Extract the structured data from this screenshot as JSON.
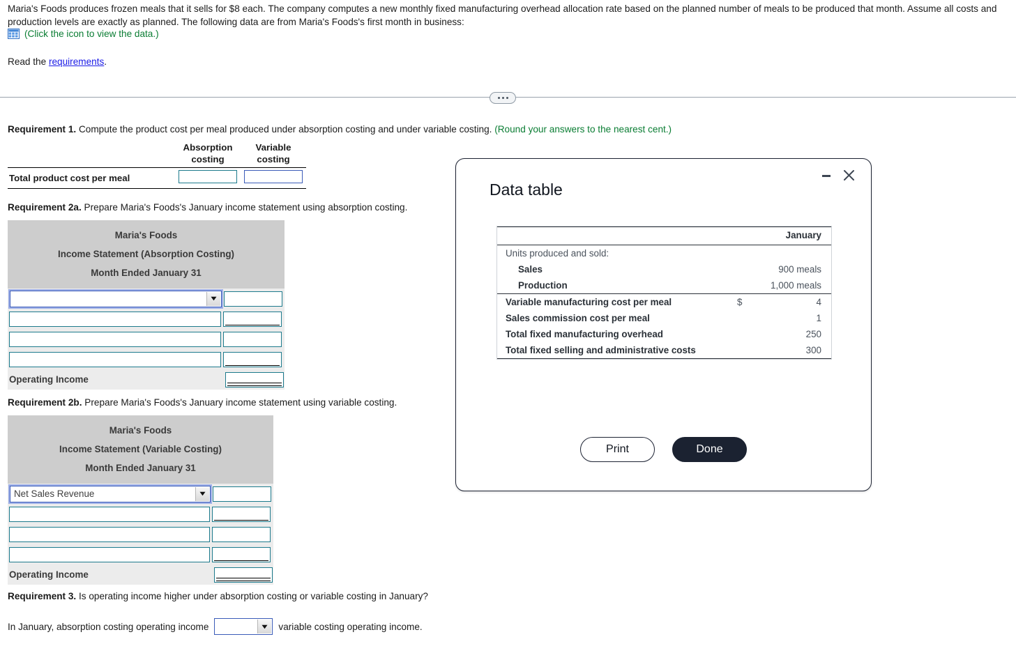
{
  "intro": {
    "paragraph": "Maria's Foods produces frozen meals that it sells for $8 each. The company computes a new monthly fixed manufacturing overhead allocation rate based on the planned number of meals to be produced that month. Assume all costs and production levels are exactly as planned. The following data are from Maria's Foods's first month in business:",
    "icon_note": "(Click the icon to view the data.)",
    "read_prefix": "Read the ",
    "read_link": "requirements",
    "read_suffix": "."
  },
  "requirement1": {
    "heading_bold": "Requirement 1.",
    "heading_text": " Compute the product cost per meal produced under absorption costing and under variable costing. ",
    "heading_note": "(Round your answers to the nearest cent.)",
    "col1_line1": "Absorption",
    "col1_line2": "costing",
    "col2_line1": "Variable",
    "col2_line2": "costing",
    "row_label": "Total product cost per meal",
    "absorption_value": "",
    "variable_value": ""
  },
  "requirement2a": {
    "heading_bold": "Requirement 2a.",
    "heading_text": " Prepare Maria's Foods's January income statement using absorption costing.",
    "title_line1": "Maria's Foods",
    "title_line2": "Income Statement (Absorption Costing)",
    "title_line3": "Month Ended January 31",
    "rows": [
      {
        "label": "",
        "value": "",
        "is_select": true,
        "underline": "none"
      },
      {
        "label": "",
        "value": "",
        "is_select": false,
        "underline": "single"
      },
      {
        "label": "",
        "value": "",
        "is_select": false,
        "underline": "none"
      },
      {
        "label": "",
        "value": "",
        "is_select": false,
        "underline": "single"
      }
    ],
    "total_label": "Operating Income",
    "total_value": "",
    "total_underline": "double"
  },
  "requirement2b": {
    "heading_bold": "Requirement 2b.",
    "heading_text": " Prepare Maria's Foods's January income statement using variable costing.",
    "title_line1": "Maria's Foods",
    "title_line2": "Income Statement (Variable Costing)",
    "title_line3": "Month Ended January 31",
    "rows": [
      {
        "label": "Net Sales Revenue",
        "value": "",
        "is_select": true,
        "underline": "none"
      },
      {
        "label": "",
        "value": "",
        "is_select": false,
        "underline": "single"
      },
      {
        "label": "",
        "value": "",
        "is_select": false,
        "underline": "none"
      },
      {
        "label": "",
        "value": "",
        "is_select": false,
        "underline": "single"
      }
    ],
    "total_label": "Operating Income",
    "total_value": "",
    "total_underline": "double"
  },
  "requirement3": {
    "heading_bold": "Requirement 3.",
    "heading_text": " Is operating income higher under absorption costing or variable costing in January?",
    "answer_prefix": "In January, absorption costing operating income",
    "answer_value": "",
    "answer_suffix": "variable costing operating income."
  },
  "dialog": {
    "title": "Data table",
    "minimize_icon": "minimize-icon",
    "close_icon": "close-icon",
    "print_label": "Print",
    "done_label": "Done",
    "table": {
      "column_header": "January",
      "rows": [
        {
          "label": "Units produced and sold:",
          "symbol": "",
          "value": "",
          "style": "plain",
          "sep_above": false
        },
        {
          "label": "Sales",
          "symbol": "",
          "value": "900 meals",
          "style": "sub",
          "sep_above": false
        },
        {
          "label": "Production",
          "symbol": "",
          "value": "1,000 meals",
          "style": "sub",
          "sep_above": false
        },
        {
          "label": "Variable manufacturing cost per meal",
          "symbol": "$",
          "value": "4",
          "style": "bold",
          "sep_above": true
        },
        {
          "label": "Sales commission cost per meal",
          "symbol": "",
          "value": "1",
          "style": "bold",
          "sep_above": false
        },
        {
          "label": "Total fixed manufacturing overhead",
          "symbol": "",
          "value": "250",
          "style": "bold",
          "sep_above": false
        },
        {
          "label": "Total fixed selling and administrative costs",
          "symbol": "",
          "value": "300",
          "style": "bold",
          "sep_above": false
        }
      ]
    }
  },
  "colors": {
    "link": "#1a1ae6",
    "note_green": "#0a7d33",
    "input_border": "#1c7a8c",
    "focus_border": "#3a5bb8",
    "header_gray": "#cdcdcd",
    "body_gray": "#ececec",
    "dialog_dark": "#1b2231"
  }
}
